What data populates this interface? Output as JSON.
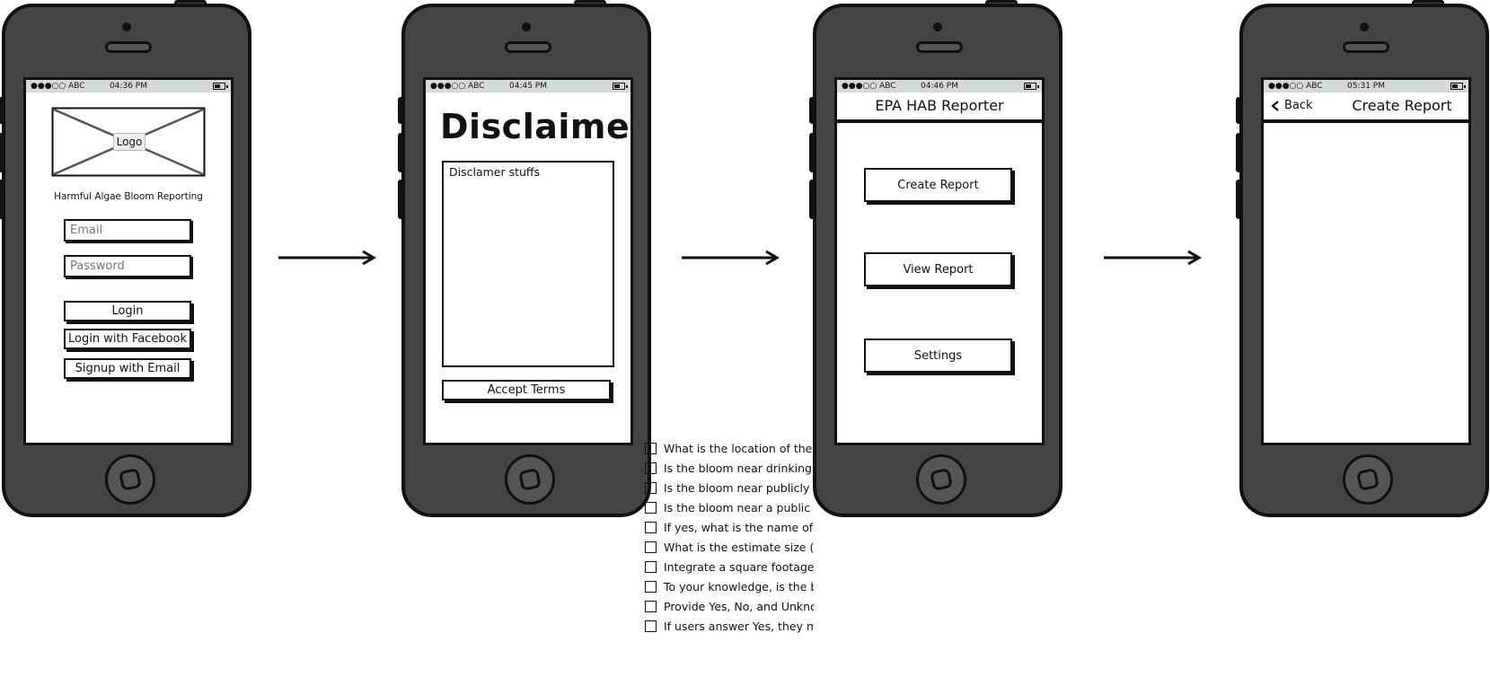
{
  "status_carrier": "●●●○○ ABC",
  "screen1": {
    "time": "04:36 PM",
    "logo_label": "Logo",
    "app_subtitle": "Harmful Algae Bloom Reporting",
    "email_placeholder": "Email",
    "password_placeholder": "Password",
    "login_label": "Login",
    "login_facebook_label": "Login with Facebook",
    "signup_email_label": "Signup with Email"
  },
  "screen2": {
    "time": "04:45 PM",
    "title": "Disclaimer",
    "body_text": "Disclamer stuffs",
    "accept_label": "Accept Terms"
  },
  "screen3": {
    "time": "04:46 PM",
    "header_title": "EPA HAB Reporter",
    "create_report_label": "Create Report",
    "view_report_label": "View Report",
    "settings_label": "Settings"
  },
  "screen4": {
    "time": "05:31 PM",
    "back_label": "Back",
    "header_title": "Create Report"
  },
  "checklist": [
    "What is the location of the bl",
    "Is the bloom near drinking w",
    "Is the bloom near publicly ow",
    "Is the bloom near a public be",
    "If yes, what is the name of th",
    "What is the estimate size (sc",
    "Integrate a square footage c",
    "To your knowledge, is the blo",
    "Provide Yes, No, and Unknow",
    "If users answer Yes, they mu"
  ],
  "icons": {
    "arrow": "right-arrow-icon",
    "back": "chevron-left-icon",
    "battery": "battery-icon"
  }
}
